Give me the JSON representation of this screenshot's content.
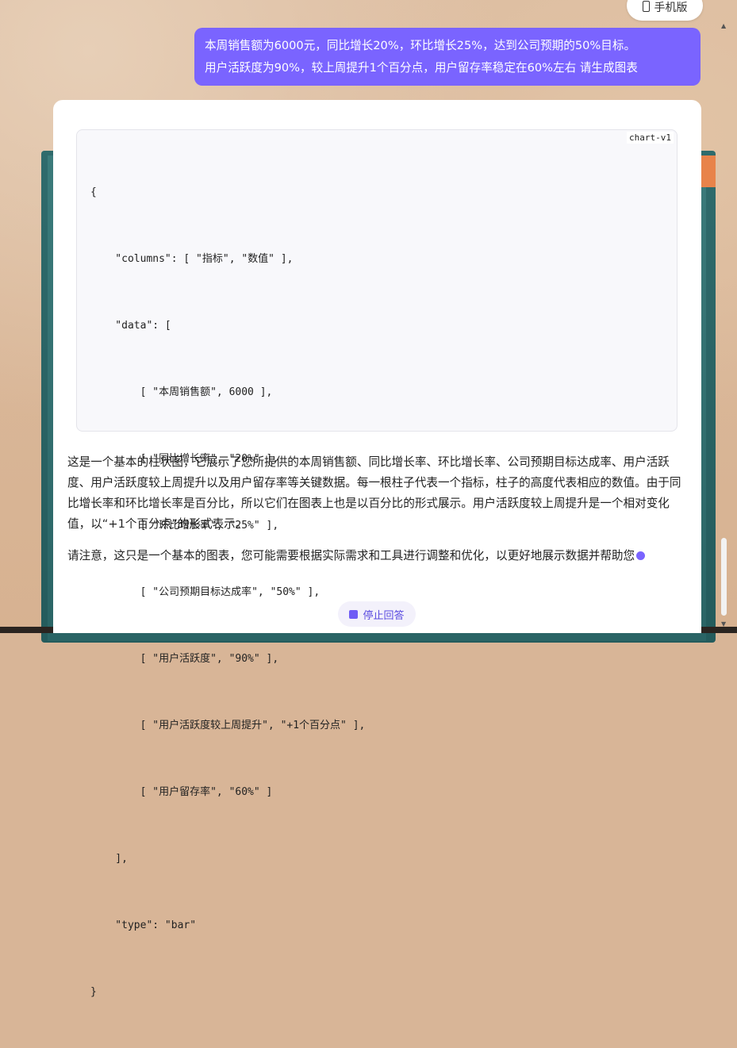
{
  "header": {
    "mobile_label": "手机版"
  },
  "user_message": {
    "lines": [
      "本周销售额为6000元，同比增长20%，环比增长25%，达到公司预期的50%目标。",
      "用户活跃度为90%，较上周提升1个百分点，用户留存率稳定在60%左右 请生成图表"
    ]
  },
  "code_block": {
    "tag": "chart-v1",
    "lines": [
      "{",
      "    \"columns\": [ \"指标\", \"数值\" ],",
      "    \"data\": [",
      "        [ \"本周销售额\", 6000 ],",
      "        [ \"同比增长率\", \"20%\" ],",
      "        [ \"环比增长率\", \"25%\" ],",
      "        [ \"公司预期目标达成率\", \"50%\" ],",
      "        [ \"用户活跃度\", \"90%\" ],",
      "        [ \"用户活跃度较上周提升\", \"+1个百分点\" ],",
      "        [ \"用户留存率\", \"60%\" ]",
      "    ],",
      "    \"type\": \"bar\"",
      "}"
    ]
  },
  "answer": {
    "paragraph1": "这是一个基本的柱状图，它展示了您所提供的本周销售额、同比增长率、环比增长率、公司预期目标达成率、用户活跃度、用户活跃度较上周提升以及用户留存率等关键数据。每一根柱子代表一个指标，柱子的高度代表相应的数值。由于同比增长率和环比增长率是百分比，所以它们在图表上也是以百分比的形式展示。用户活跃度较上周提升是一个相对变化值，以“+1个百分点”的形式表示。",
    "paragraph2": "请注意，这只是一个基本的图表，您可能需要根据实际需求和工具进行调整和优化，以更好地展示数据并帮助您"
  },
  "controls": {
    "stop_label": "停止回答"
  },
  "colors": {
    "accent": "#7a64ff",
    "card": "#ffffff",
    "code_bg": "#f8f8fb"
  }
}
